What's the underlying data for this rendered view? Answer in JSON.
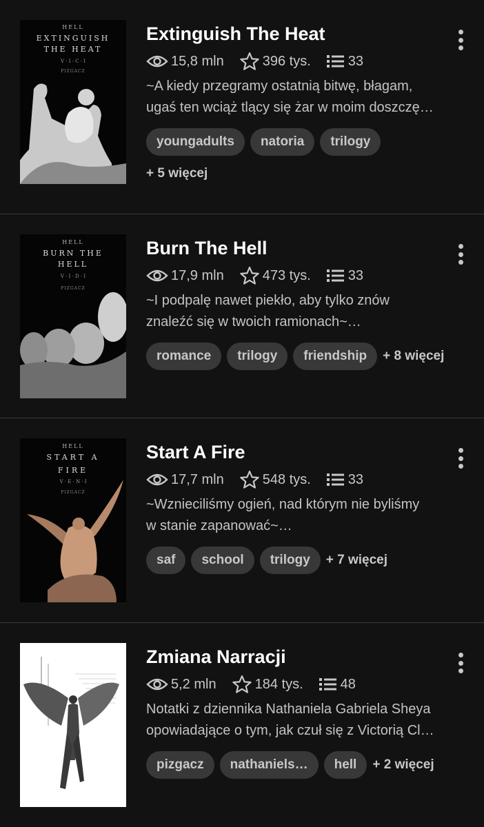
{
  "colors": {
    "background": "#121212",
    "tag_bg": "#383838",
    "text_muted": "#c4c4c4",
    "divider": "#3a3a3a"
  },
  "stories": [
    {
      "title": "Extinguish The Heat",
      "cover": {
        "top_text": "HELL",
        "title_lines": [
          "EXTINGUISH",
          "THE HEAT"
        ],
        "letters": "V · I · C · I",
        "author": "PIZGACZ",
        "art": "statue-fight"
      },
      "reads": "15,8 mln",
      "votes": "396 tys.",
      "parts": "33",
      "description": [
        "~A kiedy przegramy ostatnią bitwę, błagam,",
        "ugaś ten wciąż tlący się żar w moim doszczę…"
      ],
      "tags": [
        "youngadults",
        "natoria",
        "trilogy"
      ],
      "more": "+ 5 więcej"
    },
    {
      "title": "Burn The Hell",
      "cover": {
        "top_text": "HELL",
        "title_lines": [
          "BURN THE",
          "HELL"
        ],
        "letters": "V · I · D · I",
        "author": "PIZGACZ",
        "art": "statue-heads"
      },
      "reads": "17,9 mln",
      "votes": "473 tys.",
      "parts": "33",
      "description": [
        "~I podpalę nawet piekło, aby tylko znów",
        "znaleźć się w twoich ramionach~…"
      ],
      "tags": [
        "romance",
        "trilogy",
        "friendship"
      ],
      "more": "+ 8 więcej"
    },
    {
      "title": "Start A Fire",
      "cover": {
        "top_text": "HELL",
        "title_lines": [
          "START A",
          "FIRE"
        ],
        "letters": "V · E · N · I",
        "author": "PIZGACZ",
        "art": "winged-statue"
      },
      "reads": "17,7 mln",
      "votes": "548 tys.",
      "parts": "33",
      "description": [
        "~Wznieciliśmy ogień, nad którym nie byliśmy",
        "w stanie zapanować~…"
      ],
      "tags": [
        "saf",
        "school",
        "trilogy"
      ],
      "more": "+ 7 więcej"
    },
    {
      "title": "Zmiana Narracji",
      "cover": {
        "art": "angel-sketch"
      },
      "reads": "5,2 mln",
      "votes": "184 tys.",
      "parts": "48",
      "description": [
        "Notatki z dziennika Nathaniela Gabriela Sheya",
        "opowiadające o tym, jak czuł się z Victorią Cl…"
      ],
      "tags": [
        "pizgacz",
        "nathaniels…",
        "hell"
      ],
      "more": "+ 2 więcej"
    }
  ]
}
